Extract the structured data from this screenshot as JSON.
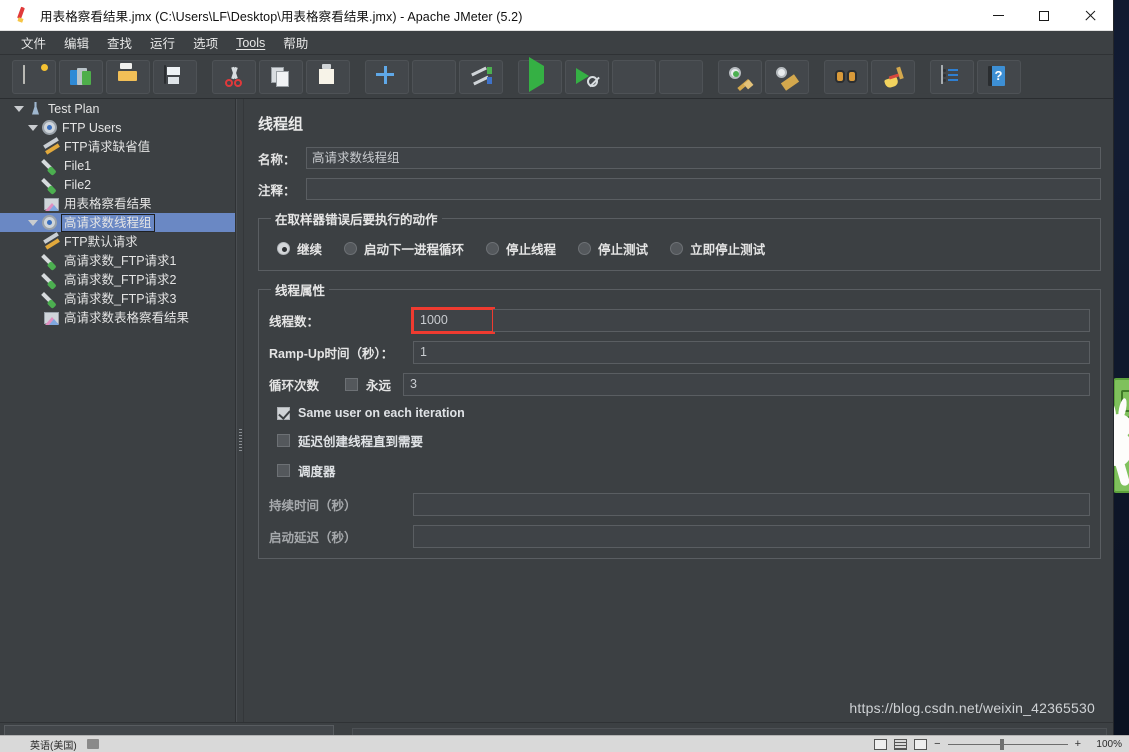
{
  "window": {
    "title": "用表格察看结果.jmx (C:\\Users\\LF\\Desktop\\用表格察看结果.jmx) - Apache JMeter (5.2)",
    "app_icon": "jmeter-feather-icon",
    "minimize_label": "—",
    "maximize_label": "□",
    "close_label": "✕"
  },
  "menubar": {
    "items": [
      {
        "label": "文件",
        "underlined": false
      },
      {
        "label": "编辑",
        "underlined": false
      },
      {
        "label": "查找",
        "underlined": false
      },
      {
        "label": "运行",
        "underlined": false
      },
      {
        "label": "选项",
        "underlined": false
      },
      {
        "label": "Tools",
        "underlined": true
      },
      {
        "label": "帮助",
        "underlined": false
      }
    ]
  },
  "toolbar": {
    "buttons": [
      {
        "name": "new-test-plan",
        "icon": "new-document-icon"
      },
      {
        "name": "templates",
        "icon": "templates-icon"
      },
      {
        "name": "open",
        "icon": "open-folder-icon"
      },
      {
        "name": "save",
        "icon": "save-floppy-icon"
      },
      {
        "separator_after": true
      },
      {
        "name": "cut",
        "icon": "scissors-icon"
      },
      {
        "name": "copy",
        "icon": "copy-icon"
      },
      {
        "name": "paste",
        "icon": "clipboard-paste-icon"
      },
      {
        "separator_after": true
      },
      {
        "name": "expand-all",
        "icon": "plus-icon"
      },
      {
        "name": "collapse-all",
        "icon": "minus-icon"
      },
      {
        "name": "toggle",
        "icon": "toggle-icon"
      },
      {
        "separator_after": true
      },
      {
        "name": "start",
        "icon": "start-play-icon"
      },
      {
        "name": "start-no-pauses",
        "icon": "start-no-pauses-icon"
      },
      {
        "name": "stop",
        "icon": "stop-icon"
      },
      {
        "name": "shutdown",
        "icon": "shutdown-icon"
      },
      {
        "separator_after": true
      },
      {
        "name": "clear",
        "icon": "clear-gear-broom-icon"
      },
      {
        "name": "clear-all",
        "icon": "clear-all-broom-icon"
      },
      {
        "separator_after": true
      },
      {
        "name": "search",
        "icon": "binoculars-icon"
      },
      {
        "name": "reset-search",
        "icon": "broom-icon"
      },
      {
        "separator_after": true
      },
      {
        "name": "function-helper",
        "icon": "function-helper-icon"
      },
      {
        "name": "help",
        "icon": "help-book-icon"
      }
    ]
  },
  "tree": {
    "nodes": [
      {
        "label": "Test Plan",
        "depth": 0,
        "icon": "test-plan-icon",
        "twisty": "open",
        "selected": false
      },
      {
        "label": "FTP Users",
        "depth": 1,
        "icon": "thread-group-icon",
        "twisty": "open",
        "selected": false
      },
      {
        "label": "FTP请求缺省值",
        "depth": 2,
        "icon": "config-element-icon",
        "twisty": "none",
        "selected": false
      },
      {
        "label": "File1",
        "depth": 2,
        "icon": "sampler-icon",
        "twisty": "none",
        "selected": false
      },
      {
        "label": "File2",
        "depth": 2,
        "icon": "sampler-icon",
        "twisty": "none",
        "selected": false
      },
      {
        "label": "用表格察看结果",
        "depth": 2,
        "icon": "listener-icon",
        "twisty": "none",
        "selected": false
      },
      {
        "label": "高请求数线程组",
        "depth": 1,
        "icon": "thread-group-icon",
        "twisty": "open",
        "selected": true
      },
      {
        "label": "FTP默认请求",
        "depth": 2,
        "icon": "config-element-icon",
        "twisty": "none",
        "selected": false
      },
      {
        "label": "高请求数_FTP请求1",
        "depth": 2,
        "icon": "sampler-icon",
        "twisty": "none",
        "selected": false
      },
      {
        "label": "高请求数_FTP请求2",
        "depth": 2,
        "icon": "sampler-icon",
        "twisty": "none",
        "selected": false
      },
      {
        "label": "高请求数_FTP请求3",
        "depth": 2,
        "icon": "sampler-icon",
        "twisty": "none",
        "selected": false
      },
      {
        "label": "高请求数表格察看结果",
        "depth": 2,
        "icon": "listener-icon",
        "twisty": "none",
        "selected": false
      }
    ]
  },
  "main": {
    "panel_title": "线程组",
    "name_label": "名称：",
    "name_value": "高请求数线程组",
    "comment_label": "注释：",
    "comment_value": "",
    "error_action": {
      "legend": "在取样器错误后要执行的动作",
      "options": [
        {
          "label": "继续",
          "checked": true
        },
        {
          "label": "启动下一进程循环",
          "checked": false
        },
        {
          "label": "停止线程",
          "checked": false
        },
        {
          "label": "停止测试",
          "checked": false
        },
        {
          "label": "立即停止测试",
          "checked": false
        }
      ]
    },
    "thread_properties": {
      "legend": "线程属性",
      "threads_label": "线程数：",
      "threads_value": "1000",
      "threads_highlight_color": "#ef3b30",
      "rampup_label": "Ramp-Up时间（秒）：",
      "rampup_value": "1",
      "loops_label": "循环次数",
      "forever_label": "永远",
      "forever_checked": false,
      "loops_value": "3",
      "same_user_label": "Same user on each iteration",
      "same_user_checked": true,
      "delayed_start_label": "延迟创建线程直到需要",
      "delayed_start_checked": false,
      "scheduler_label": "调度器",
      "scheduler_checked": false,
      "duration_label": "持续时间（秒）",
      "duration_value": "",
      "startup_delay_label": "启动延迟（秒）",
      "startup_delay_value": ""
    },
    "watermark": "https://blog.csdn.net/weixin_42365530"
  },
  "background_statusbar": {
    "ime_language": "英语(美国)",
    "ime_icon": "ime-keyboard-icon",
    "zoom_out_label": "−",
    "zoom_in_label": "+",
    "zoom_value": "100%"
  }
}
